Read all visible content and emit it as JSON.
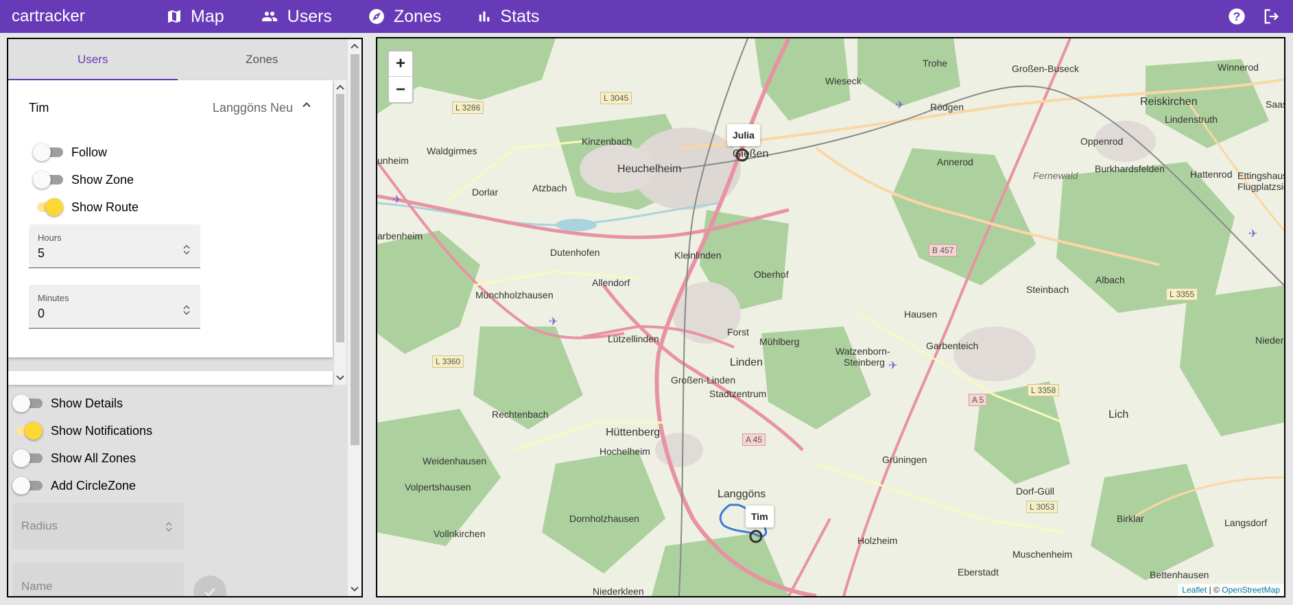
{
  "app": {
    "title": "cartracker"
  },
  "nav": [
    {
      "label": "Map",
      "icon": "map-icon"
    },
    {
      "label": "Users",
      "icon": "users-icon"
    },
    {
      "label": "Zones",
      "icon": "compass-icon"
    },
    {
      "label": "Stats",
      "icon": "bar-chart-icon"
    }
  ],
  "topRight": {
    "help_icon": "help-icon",
    "logout_icon": "logout-icon"
  },
  "sidebar": {
    "tabs": [
      "Users",
      "Zones"
    ],
    "activeTab": "Users",
    "userCard": {
      "name": "Tim",
      "location": "Langgöns Neu",
      "toggles": [
        {
          "label": "Follow",
          "on": false
        },
        {
          "label": "Show Zone",
          "on": false
        },
        {
          "label": "Show Route",
          "on": true
        }
      ],
      "hours": {
        "label": "Hours",
        "value": "5"
      },
      "minutes": {
        "label": "Minutes",
        "value": "0"
      }
    },
    "globalToggles": [
      {
        "label": "Show Details",
        "on": false
      },
      {
        "label": "Show Notifications",
        "on": true
      },
      {
        "label": "Show All Zones",
        "on": false
      },
      {
        "label": "Add CircleZone",
        "on": false
      }
    ],
    "radius": {
      "placeholder": "Radius"
    },
    "name": {
      "placeholder": "Name"
    }
  },
  "map": {
    "zoomIn": "+",
    "zoomOut": "−",
    "markers": [
      {
        "label": "Julia"
      },
      {
        "label": "Tim"
      }
    ],
    "attribution": {
      "leaflet": "Leaflet",
      "sep": " | © ",
      "osm": "OpenStreetMap"
    },
    "places": {
      "giessen": "Gießen",
      "heuchelheim": "Heuchelheim",
      "wieseck": "Wieseck",
      "trohe": "Trohe",
      "grossenbuseck": "Großen-Buseck",
      "winnerod": "Winnerod",
      "roedgen": "Rödgen",
      "reiskirchen": "Reiskirchen",
      "lindenstruth": "Lindenstruth",
      "saasen": "Saas",
      "oppenrod": "Oppenrod",
      "annerod": "Annerod",
      "burkhardsfelden": "Burkhardsfelden",
      "hattenrod": "Hattenrod",
      "ettingshausen": "Ettingshause",
      "flugplatz": "Flugplatzsied",
      "fernewald": "Fernewald",
      "kinzenbach": "Kinzenbach",
      "waldgirmes": "Waldgirmes",
      "dorlar": "Dorlar",
      "atzbach": "Atzbach",
      "unheim": "unheim",
      "arbenheim": "arbenheim",
      "dutenhofen": "Dutenhofen",
      "kleinlinden": "Kleinlinden",
      "allendorf": "Allendorf",
      "oberhof": "Oberhof",
      "muenchholzhausen": "Münchholzhausen",
      "steinbach": "Steinbach",
      "albach": "Albach",
      "hausen": "Hausen",
      "luetzellinden": "Lützellinden",
      "forst": "Forst",
      "muehlberg": "Mühlberg",
      "watzenborn": "Watzenborn-",
      "steinberg": "Steinberg",
      "garbenteich": "Garbenteich",
      "niederbe": "Nieder-Be",
      "linden": "Linden",
      "grossenlinden": "Großen-Linden",
      "stadtzentrum": "Stadtzentrum",
      "lich": "Lich",
      "rechtenbach": "Rechtenbach",
      "huettenberg": "Hüttenberg",
      "hochelheim": "Hochelheim",
      "weidenhausen": "Weidenhausen",
      "grueningen": "Grüningen",
      "volpertshausen": "Volpertshausen",
      "langgoens": "Langgöns",
      "dorfguell": "Dorf-Güll",
      "birklar": "Birklar",
      "langsdorf": "Langsdorf",
      "dornholzhausen": "Dornholzhausen",
      "vollnkirchen": "Vollnkirchen",
      "holzheim": "Holzheim",
      "muschenheim": "Muschenheim",
      "eberstadt": "Eberstadt",
      "bettenhausen": "Bettenhausen",
      "niederkleen": "Niederkleen"
    },
    "roads": {
      "l3286": "L 3286",
      "l3045": "L 3045",
      "b457": "B 457",
      "l3355": "L 3355",
      "l3360": "L 3360",
      "l3358": "L 3358",
      "a5": "A 5",
      "a45": "A 45",
      "l3053": "L 3053"
    }
  }
}
